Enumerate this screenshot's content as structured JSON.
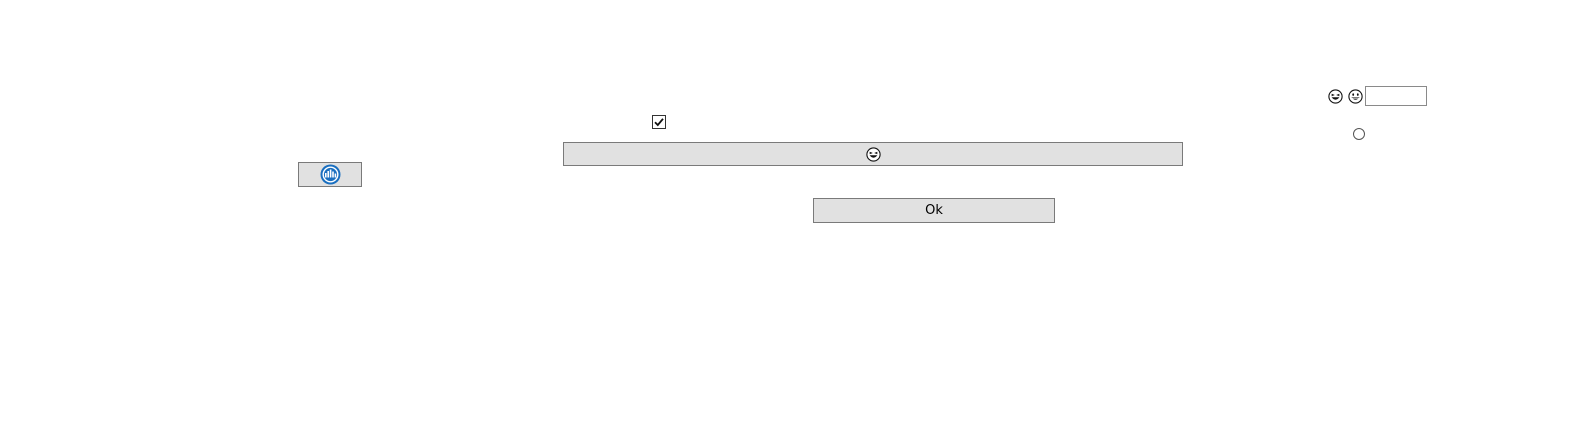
{
  "icons": {
    "logo": "blue-circle-logo-icon",
    "emoji_button": "grinning-squint-emoji-icon",
    "top_emoji_1": "grinning-squint-emoji-icon",
    "top_emoji_2": "grinning-face-emoji-icon",
    "checkbox": "checkmark-icon"
  },
  "colors": {
    "button_bg": "#e1e1e1",
    "button_border": "#7a7a7a",
    "logo_blue": "#1a6fc0"
  },
  "checkbox": {
    "checked": true
  },
  "radio": {
    "selected": false
  },
  "text_field": {
    "value": "",
    "placeholder": ""
  },
  "ok_button": {
    "label": "Ok"
  }
}
